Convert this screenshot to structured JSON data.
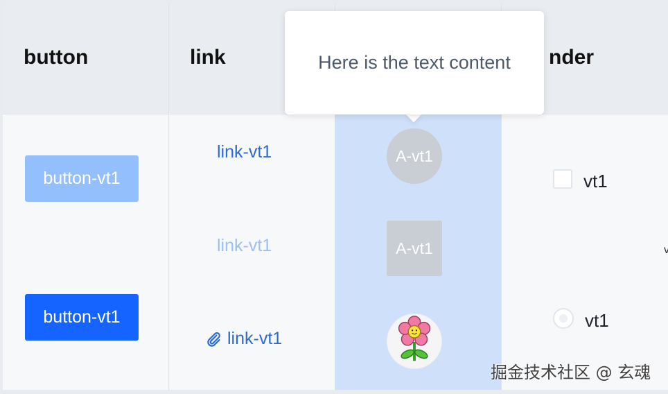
{
  "table": {
    "headers": {
      "button": "button",
      "link": "link",
      "render": "nder"
    },
    "buttons": [
      "button-vt1",
      "button-vt1"
    ],
    "links": [
      "link-vt1",
      "link-vt1",
      "link-vt1"
    ],
    "avatars": [
      "A-vt1",
      "A-vt1"
    ],
    "checkbox_label": "vt1",
    "radio_label": "vt1",
    "edge_glyph": "v"
  },
  "tooltip": {
    "text": "Here is the text content"
  },
  "watermark": "掘金技术社区 @ 玄魂",
  "colors": {
    "primary": "#1664ff",
    "primary_light": "#94bffd",
    "link": "#2e6bd1",
    "selected_column": "#cfe0fb"
  },
  "icons": {
    "link_icon": "paperclip-icon",
    "avatar_image": "flower-icon"
  }
}
